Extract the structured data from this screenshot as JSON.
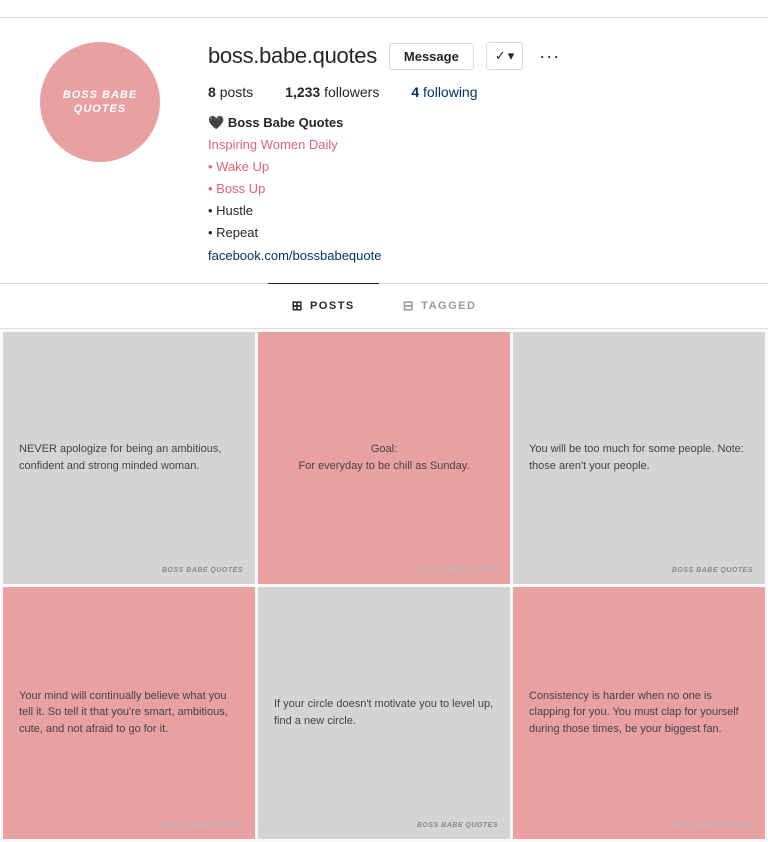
{
  "topbar": {
    "text": ""
  },
  "profile": {
    "username": "boss.babe.quotes",
    "avatar_text": "BOSS BABE QUOTES",
    "avatar_bg": "#e8a0a0",
    "stats": {
      "posts_label": "posts",
      "posts_count": "8",
      "followers_label": "followers",
      "followers_count": "1,233",
      "following_label": "following",
      "following_count": "4"
    },
    "bio": {
      "heart": "🖤",
      "name": "Boss Babe Quotes",
      "tagline": "Inspiring Women Daily",
      "bullet1": "• Wake Up",
      "bullet2": "• Boss Up",
      "bullet3": "• Hustle",
      "bullet4": "• Repeat",
      "link": "facebook.com/bossbabequote"
    },
    "buttons": {
      "message": "Message",
      "follow_check": "✓",
      "follow_arrow": "▾",
      "more": "···"
    }
  },
  "tabs": [
    {
      "id": "posts",
      "label": "POSTS",
      "icon": "⊞",
      "active": true
    },
    {
      "id": "tagged",
      "label": "TAGGED",
      "icon": "⊟",
      "active": false
    }
  ],
  "grid": [
    {
      "id": 1,
      "bg": "gray",
      "text": "NEVER apologize for being an ambitious, confident and strong minded woman.",
      "watermark": "BOSS BABE QUOTES",
      "centered": false
    },
    {
      "id": 2,
      "bg": "pink",
      "text": "Goal:\nFor everyday to be chill as Sunday.",
      "watermark": "BOSS BABE QUOTES",
      "centered": true
    },
    {
      "id": 3,
      "bg": "gray",
      "text": "You will be too much for some people. Note: those aren't your people.",
      "watermark": "BOSS BABE QUOTES",
      "centered": false
    },
    {
      "id": 4,
      "bg": "pink",
      "text": "Your mind will continually believe what you tell it. So tell it that you're smart, ambitious, cute, and not afraid to go for it.",
      "watermark": "BOSS BABE QUOTES",
      "centered": false
    },
    {
      "id": 5,
      "bg": "gray",
      "text": "If your circle doesn't motivate you to level up, find a new circle.",
      "watermark": "BOSS BABE QUOTES",
      "centered": false
    },
    {
      "id": 6,
      "bg": "pink",
      "text": "Consistency is harder when no one is clapping for you. You must clap for yourself during those times, be your biggest fan.",
      "watermark": "BOSS BABE QUOTES",
      "centered": false
    }
  ]
}
